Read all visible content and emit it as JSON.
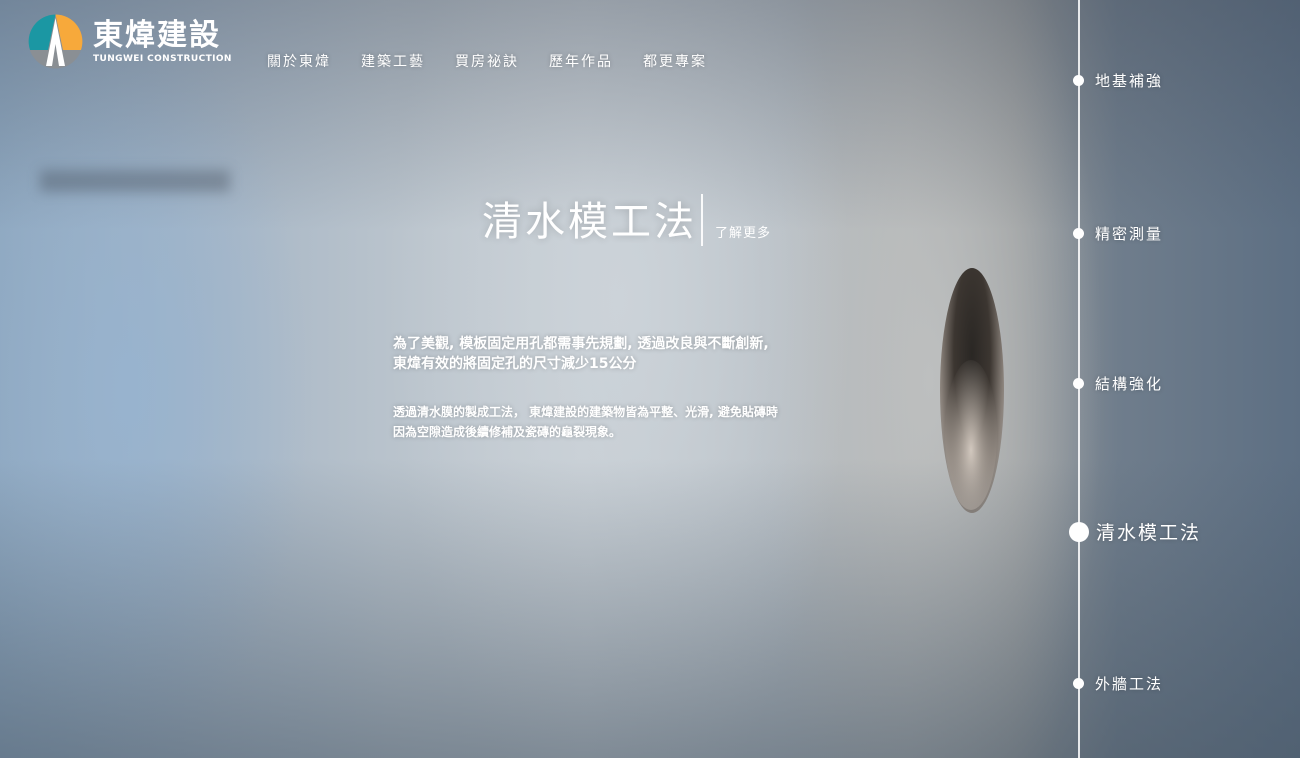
{
  "brand": {
    "name_cn": "東煒建設",
    "name_en": "TUNGWEI CONSTRUCTION",
    "colors": {
      "teal": "#1b97a3",
      "orange": "#f7a93b",
      "gray": "#8a8f94"
    }
  },
  "nav": {
    "items": [
      {
        "label": "關於東煒"
      },
      {
        "label": "建築工藝"
      },
      {
        "label": "買房祕訣"
      },
      {
        "label": "歷年作品"
      },
      {
        "label": "都更專案"
      }
    ]
  },
  "hero": {
    "title": "清水模工法",
    "more_link": "了解更多",
    "desc1": "為了美觀, 模板固定用孔都需事先規劃, 透過改良與不斷創新, 東煒有效的將固定孔的尺寸減少15公分",
    "desc2": "透過清水膜的製成工法， 東煒建設的建築物皆為平整、光滑, 避免貼磚時因為空隙造成後續修補及瓷磚的龜裂現象。"
  },
  "timeline": {
    "items": [
      {
        "label": "地基補強",
        "active": false
      },
      {
        "label": "精密測量",
        "active": false
      },
      {
        "label": "結構強化",
        "active": false
      },
      {
        "label": "清水模工法",
        "active": true
      },
      {
        "label": "外牆工法",
        "active": false
      }
    ]
  }
}
